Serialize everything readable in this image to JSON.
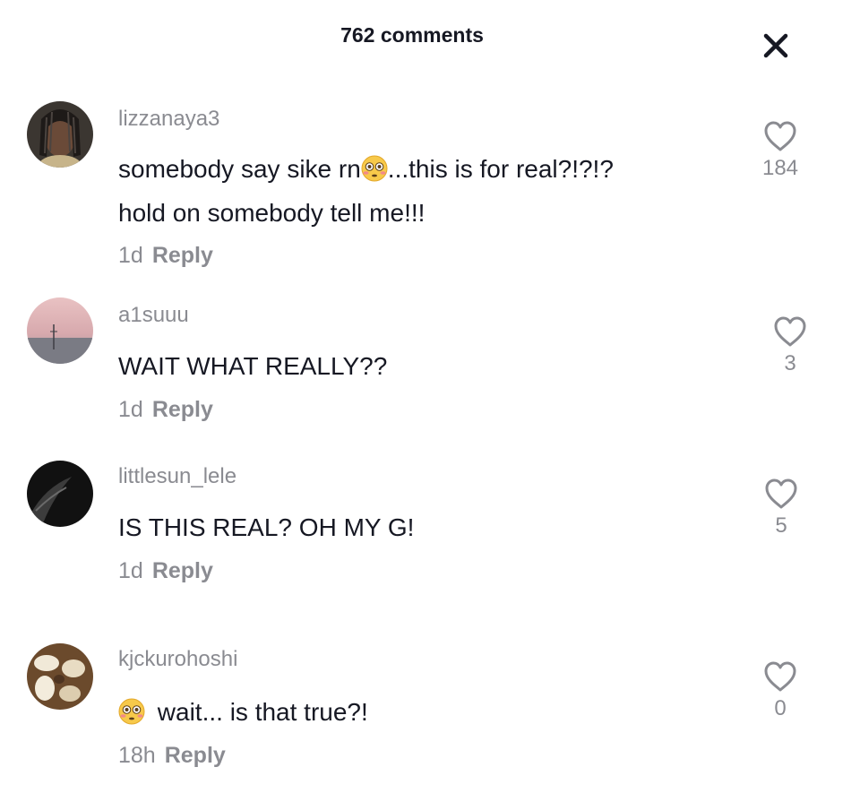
{
  "header": {
    "title": "762 comments",
    "close_icon": "close-icon"
  },
  "comments": [
    {
      "username": "lizzanaya3",
      "text_part1": "somebody say sike rn",
      "emoji": "flushed-face-emoji",
      "text_part2": "...this is for real?!?!?",
      "text_line2": "hold on somebody tell me!!!",
      "time": "1d",
      "reply": "Reply",
      "likes": "184"
    },
    {
      "username": "a1suuu",
      "text": "WAIT WHAT REALLY??",
      "time": "1d",
      "reply": "Reply",
      "likes": "3"
    },
    {
      "username": "littlesun_lele",
      "text": "IS THIS REAL? OH MY G!",
      "time": "1d",
      "reply": "Reply",
      "likes": "5"
    },
    {
      "username": "kjckurohoshi",
      "emoji": "flushed-face-emoji",
      "text": "wait... is that true?!",
      "time": "18h",
      "reply": "Reply",
      "likes": "0"
    }
  ],
  "colors": {
    "primary_text": "#161823",
    "secondary_text": "#8a8b91",
    "background": "#ffffff"
  }
}
